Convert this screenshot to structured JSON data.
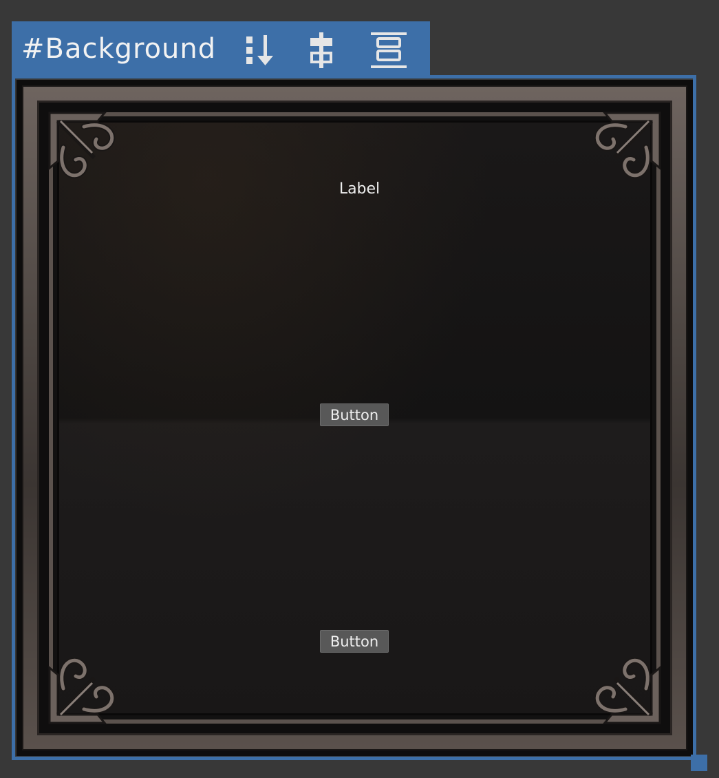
{
  "selection": {
    "element_name": "#Background",
    "icons": [
      "flex-direction-column-icon",
      "justify-center-icon",
      "align-stretch-icon"
    ]
  },
  "panel": {
    "label": "Label",
    "buttons": [
      {
        "label": "Button"
      },
      {
        "label": "Button"
      }
    ]
  },
  "colors": {
    "selection_accent": "#3d6fa8",
    "workspace_background": "#383838",
    "button_background": "#585858",
    "frame_metal": "#5b524d"
  }
}
